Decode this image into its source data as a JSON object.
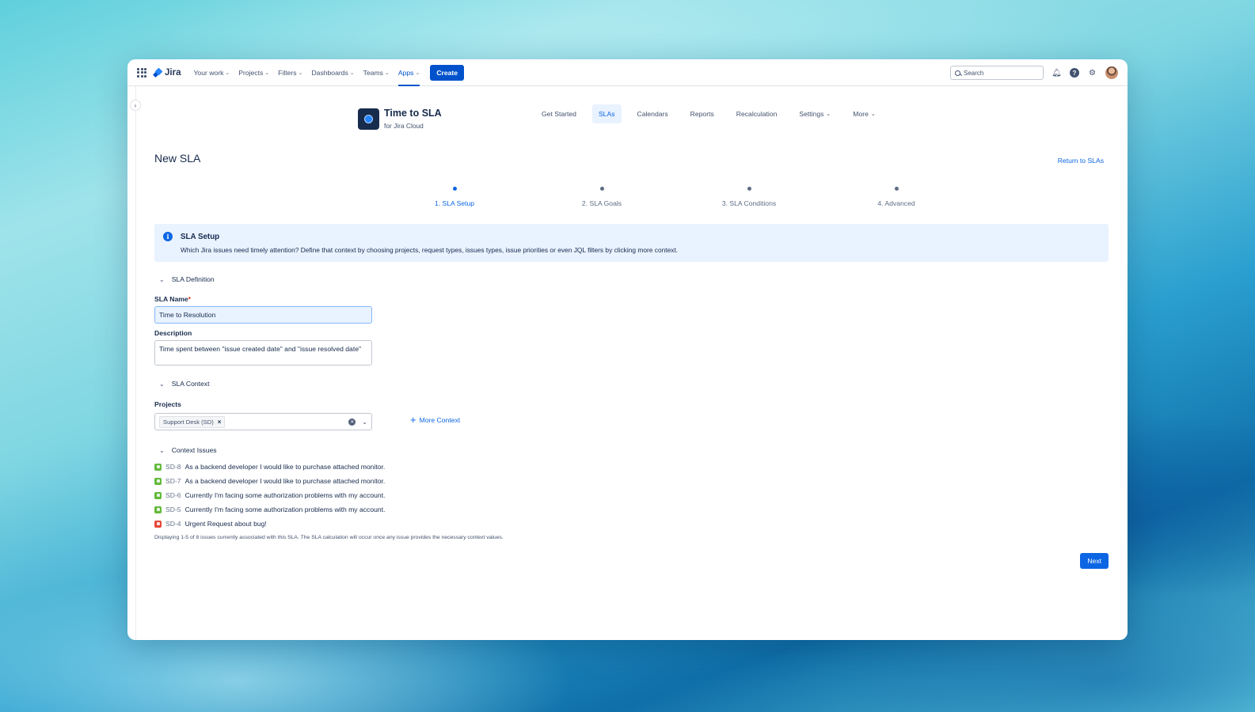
{
  "nav": {
    "logo": "Jira",
    "items": [
      {
        "label": "Your work"
      },
      {
        "label": "Projects"
      },
      {
        "label": "Filters"
      },
      {
        "label": "Dashboards"
      },
      {
        "label": "Teams"
      },
      {
        "label": "Apps"
      }
    ],
    "create_label": "Create",
    "search_placeholder": "Search"
  },
  "app": {
    "title": "Time to SLA",
    "subtitle": "for Jira Cloud",
    "tabs": [
      {
        "label": "Get Started"
      },
      {
        "label": "SLAs"
      },
      {
        "label": "Calendars"
      },
      {
        "label": "Reports"
      },
      {
        "label": "Recalculation"
      },
      {
        "label": "Settings"
      },
      {
        "label": "More"
      }
    ]
  },
  "page": {
    "title": "New SLA",
    "return_link": "Return to SLAs"
  },
  "steps": [
    {
      "label": "1. SLA Setup"
    },
    {
      "label": "2. SLA Goals"
    },
    {
      "label": "3. SLA Conditions"
    },
    {
      "label": "4. Advanced"
    }
  ],
  "info": {
    "title": "SLA Setup",
    "text": "Which Jira issues need timely attention? Define that context by choosing projects, request types, issues types, issue priorities or even JQL filters by clicking more context."
  },
  "definition": {
    "heading": "SLA Definition",
    "name_label": "SLA Name",
    "required_mark": "*",
    "name_value": "Time to Resolution",
    "description_label": "Description",
    "description_value": "Time spent between \"issue created date\" and \"issue resolved date\""
  },
  "context": {
    "heading": "SLA Context",
    "projects_label": "Projects",
    "project_tag": "Support Desk (SD)",
    "tag_remove": "×",
    "more_context": "More Context"
  },
  "issues": {
    "heading": "Context Issues",
    "items": [
      {
        "key": "SD-8",
        "summary": "As a backend developer I would like to purchase attached monitor.",
        "type": "story"
      },
      {
        "key": "SD-7",
        "summary": "As a backend developer I would like to purchase attached monitor.",
        "type": "story"
      },
      {
        "key": "SD-6",
        "summary": "Currently I'm facing some authorization problems with my account.",
        "type": "story"
      },
      {
        "key": "SD-5",
        "summary": "Currently I'm facing some authorization problems with my account.",
        "type": "story"
      },
      {
        "key": "SD-4",
        "summary": "Urgent Request about bug!",
        "type": "bug"
      }
    ],
    "footnote": "Displaying 1-5 of 8 issues currently associated with this SLA. The SLA calculation will occur once any issue provides the necessary context values."
  },
  "actions": {
    "next_label": "Next"
  },
  "colors": {
    "accent": "#0c66e4",
    "info_bg": "#e9f2ff",
    "story": "#63ba3c",
    "bug": "#e5493a"
  }
}
